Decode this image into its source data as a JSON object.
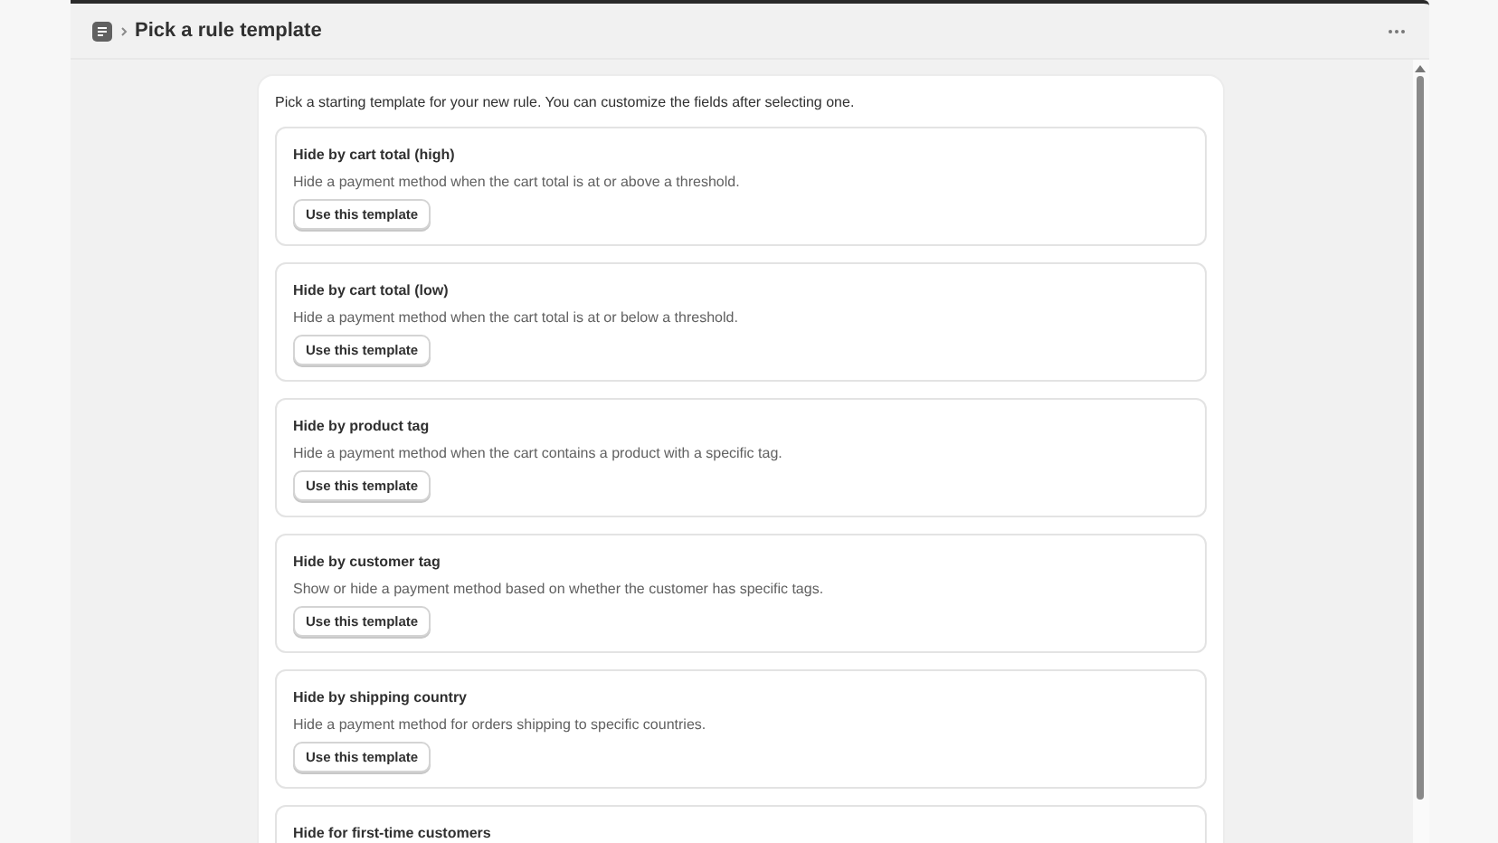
{
  "header": {
    "title": "Pick a rule template"
  },
  "intro": "Pick a starting template for your new rule. You can customize the fields after selecting one.",
  "templates": [
    {
      "title": "Hide by cart total (high)",
      "description": "Hide a payment method when the cart total is at or above a threshold.",
      "button": "Use this template"
    },
    {
      "title": "Hide by cart total (low)",
      "description": "Hide a payment method when the cart total is at or below a threshold.",
      "button": "Use this template"
    },
    {
      "title": "Hide by product tag",
      "description": "Hide a payment method when the cart contains a product with a specific tag.",
      "button": "Use this template"
    },
    {
      "title": "Hide by customer tag",
      "description": "Show or hide a payment method based on whether the customer has specific tags.",
      "button": "Use this template"
    },
    {
      "title": "Hide by shipping country",
      "description": "Hide a payment method for orders shipping to specific countries.",
      "button": "Use this template"
    },
    {
      "title": "Hide for first-time customers"
    }
  ]
}
